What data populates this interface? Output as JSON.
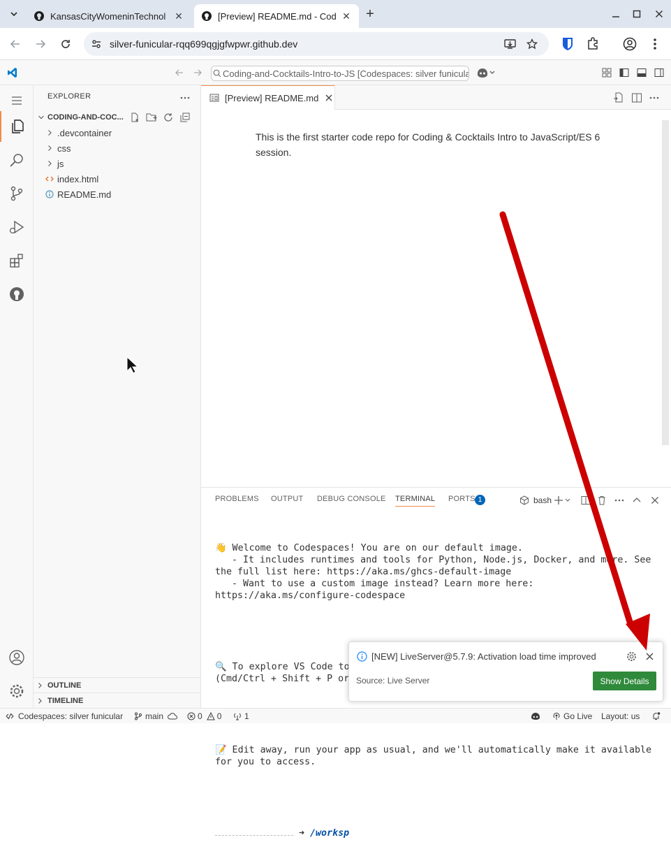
{
  "browser": {
    "tabs": [
      {
        "title": "KansasCityWomeninTechnol",
        "active": false
      },
      {
        "title": "[Preview] README.md - Cod",
        "active": true
      }
    ],
    "url": "silver-funicular-rqq699qgjgfwpwr.github.dev"
  },
  "vscode": {
    "command_center": "Coding-and-Cocktails-Intro-to-JS [Codespaces: silver funicular]",
    "explorer": {
      "header": "EXPLORER",
      "root": "CODING-AND-COC...",
      "items": [
        {
          "label": ".devcontainer",
          "type": "folder"
        },
        {
          "label": "css",
          "type": "folder"
        },
        {
          "label": "js",
          "type": "folder"
        },
        {
          "label": "index.html",
          "type": "html"
        },
        {
          "label": "README.md",
          "type": "info"
        }
      ],
      "outline": "OUTLINE",
      "timeline": "TIMELINE"
    },
    "editor": {
      "tab_label": "[Preview] README.md",
      "preview_text": "This is the first starter code repo for Coding & Cocktails Intro to JavaScript/ES 6 session."
    },
    "panel": {
      "tabs": [
        "PROBLEMS",
        "OUTPUT",
        "DEBUG CONSOLE",
        "TERMINAL",
        "PORTS"
      ],
      "active_tab": "TERMINAL",
      "ports_badge": "1",
      "shell": "bash",
      "terminal": {
        "line1": "👋 Welcome to Codespaces! You are on our default image.\n   - It includes runtimes and tools for Python, Node.js, Docker, and more. See the full list here: https://aka.ms/ghcs-default-image\n   - Want to use a custom image instead? Learn more here: https://aka.ms/configure-codespace",
        "line2": "🔍 To explore VS Code to its fullest, search using the Command Palette (Cmd/Ctrl + Shift + P or F1).",
        "line3": "📝 Edit away, run your app as usual, and we'll automatically make it available for you to access.",
        "arrow": "➜",
        "path": "/worksp"
      }
    },
    "notification": {
      "message": "[NEW] LiveServer@5.7.9: Activation load time improved",
      "source": "Source: Live Server",
      "button": "Show Details"
    },
    "status": {
      "remote": "Codespaces: silver funicular",
      "branch": "main",
      "errors": "0",
      "warnings": "0",
      "ports": "1",
      "golive": "Go Live",
      "layout": "Layout: us"
    }
  },
  "colors": {
    "accent_orange": "#f08d49",
    "vscode_blue": "#007acc",
    "button_green": "#2f8a3b",
    "arrow_red": "#cc0000",
    "badge_blue": "#0066b8"
  }
}
